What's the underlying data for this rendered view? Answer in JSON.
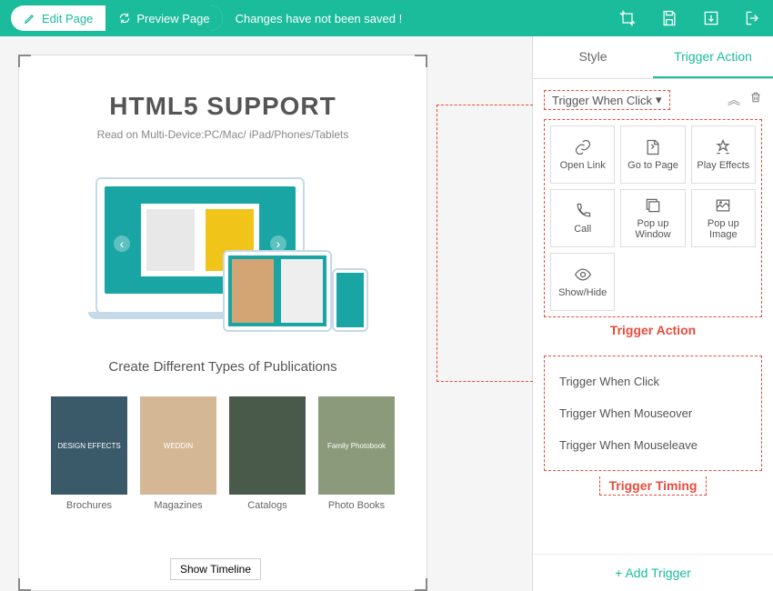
{
  "toolbar": {
    "edit_label": "Edit Page",
    "preview_label": "Preview Page",
    "unsaved_msg": "Changes have not been saved !"
  },
  "page": {
    "title": "HTML5 SUPPORT",
    "subtitle": "Read on Multi-Device:PC/Mac/ iPad/Phones/Tablets",
    "section_title": "Create Different Types of Publications",
    "pubs": [
      {
        "label": "Brochures",
        "cover_text": "DESIGN EFFECTS",
        "bg": "#3a5a6a"
      },
      {
        "label": "Magazines",
        "cover_text": "WEDDIN",
        "bg": "#d4b896"
      },
      {
        "label": "Catalogs",
        "cover_text": "",
        "bg": "#4a5a4a"
      },
      {
        "label": "Photo Books",
        "cover_text": "Family Photobook",
        "bg": "#8a9a7a"
      }
    ]
  },
  "show_timeline": "Show Timeline",
  "tabs": {
    "style": "Style",
    "trigger": "Trigger Action"
  },
  "trigger_dropdown": "Trigger When Click",
  "actions": [
    {
      "name": "open-link",
      "label": "Open Link"
    },
    {
      "name": "go-to-page",
      "label": "Go to Page"
    },
    {
      "name": "play-effects",
      "label": "Play Effects"
    },
    {
      "name": "call",
      "label": "Call"
    },
    {
      "name": "popup-window",
      "label": "Pop up Window"
    },
    {
      "name": "popup-image",
      "label": "Pop up Image"
    },
    {
      "name": "show-hide",
      "label": "Show/Hide"
    }
  ],
  "annotation_action": "Trigger Action",
  "timings": [
    "Trigger When Click",
    "Trigger When Mouseover",
    "Trigger When Mouseleave"
  ],
  "annotation_timing": "Trigger Timing",
  "add_trigger": "+ Add Trigger"
}
